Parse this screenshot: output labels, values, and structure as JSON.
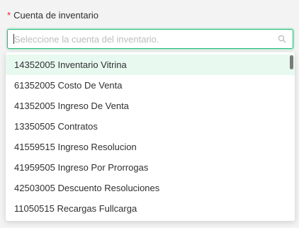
{
  "field": {
    "required_mark": "*",
    "label": "Cuenta de inventario",
    "placeholder": "Seleccione la cuenta del inventario.",
    "value": ""
  },
  "icons": {
    "search": "search-icon"
  },
  "colors": {
    "accent": "#1dbf76",
    "required": "#f5222d",
    "active_option_bg": "#e8f9f0"
  },
  "dropdown": {
    "options": [
      {
        "label": "14352005 Inventario Vitrina",
        "active": true
      },
      {
        "label": "61352005 Costo De Venta"
      },
      {
        "label": "41352005 Ingreso De Venta"
      },
      {
        "label": "13350505 Contratos"
      },
      {
        "label": "41559515 Ingreso Resolucion"
      },
      {
        "label": "41959505 Ingreso Por Prorrogas"
      },
      {
        "label": "42503005 Descuento Resoluciones"
      },
      {
        "label": "11050515 Recargas Fullcarga"
      }
    ]
  }
}
